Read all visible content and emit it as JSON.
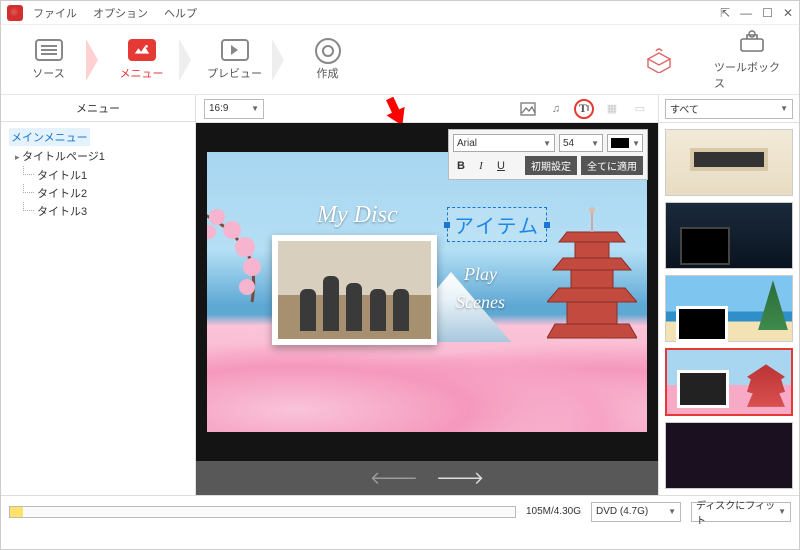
{
  "menubar": {
    "file": "ファイル",
    "option": "オプション",
    "help": "ヘルプ"
  },
  "steps": {
    "source": "ソース",
    "menu": "メニュー",
    "preview": "プレビュー",
    "create": "作成",
    "toolbox": "ツールボックス"
  },
  "sidebar": {
    "header": "メニュー",
    "main_menu": "メインメニュー",
    "title_page": "タイトルページ1",
    "titles": [
      "タイトル1",
      "タイトル2",
      "タイトル3"
    ]
  },
  "editbar": {
    "aspect": "16:9"
  },
  "canvas": {
    "disc_title": "My Disc",
    "play": "Play",
    "scenes": "Scenes",
    "text_item": "アイテム"
  },
  "format_bar": {
    "font": "Arial",
    "size": "54",
    "bold": "B",
    "italic": "I",
    "underline": "U",
    "reset": "初期設定",
    "apply_all": "全てに適用"
  },
  "thumbpane": {
    "filter": "すべて"
  },
  "status": {
    "capacity": "105M/4.30G",
    "disc": "DVD (4.7G)",
    "fit": "ディスクにフィット"
  }
}
